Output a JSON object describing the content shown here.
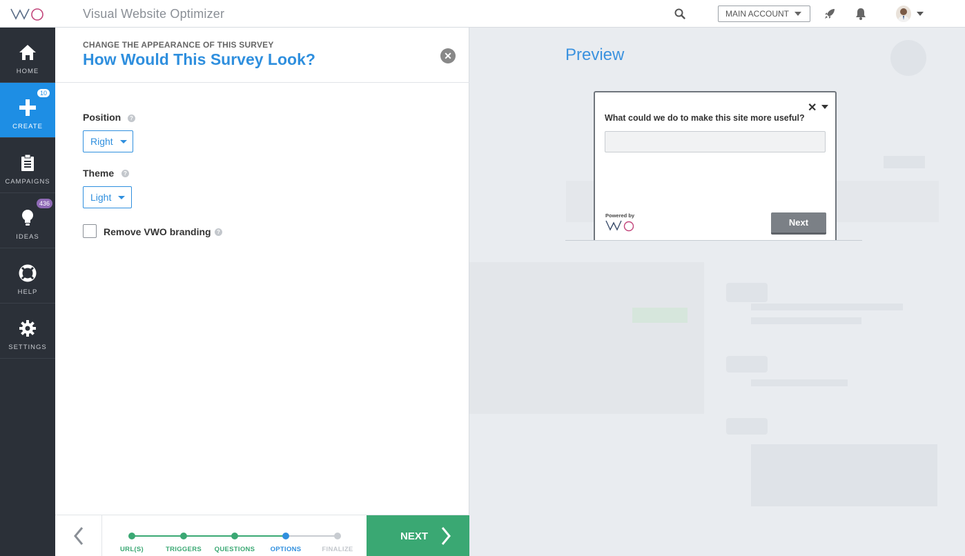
{
  "topbar": {
    "app_title": "Visual Website Optimizer",
    "account_label": "MAIN ACCOUNT"
  },
  "sidebar": {
    "items": [
      {
        "label": "HOME",
        "icon": "home-icon"
      },
      {
        "label": "CREATE",
        "icon": "plus-icon",
        "badge": "10",
        "active": true
      },
      {
        "label": "CAMPAIGNS",
        "icon": "clipboard-icon"
      },
      {
        "label": "IDEAS",
        "icon": "lightbulb-icon",
        "badge": "436"
      },
      {
        "label": "HELP",
        "icon": "lifebuoy-icon"
      },
      {
        "label": "SETTINGS",
        "icon": "gear-icon"
      }
    ]
  },
  "panel": {
    "subtitle": "CHANGE THE APPEARANCE OF THIS SURVEY",
    "title": "How Would This Survey Look?",
    "position_label": "Position",
    "position_value": "Right",
    "theme_label": "Theme",
    "theme_value": "Light",
    "branding_label": "Remove VWO branding",
    "branding_checked": false
  },
  "wizard": {
    "steps": [
      {
        "label": "URL(S)",
        "state": "done"
      },
      {
        "label": "TRIGGERS",
        "state": "done"
      },
      {
        "label": "QUESTIONS",
        "state": "done"
      },
      {
        "label": "OPTIONS",
        "state": "current"
      },
      {
        "label": "FINALIZE",
        "state": "pending"
      }
    ],
    "next_label": "NEXT"
  },
  "preview": {
    "title": "Preview",
    "survey_question": "What could we do to make this site more useful?",
    "powered_by": "Powered by",
    "survey_next": "Next"
  },
  "colors": {
    "accent": "#2f8fde",
    "sidebar_bg": "#2b3038",
    "active_nav": "#1e8ee4",
    "step_done": "#3aa873",
    "step_current": "#2f8fde",
    "step_pending": "#c8ccd1",
    "next_button": "#3aa873"
  }
}
